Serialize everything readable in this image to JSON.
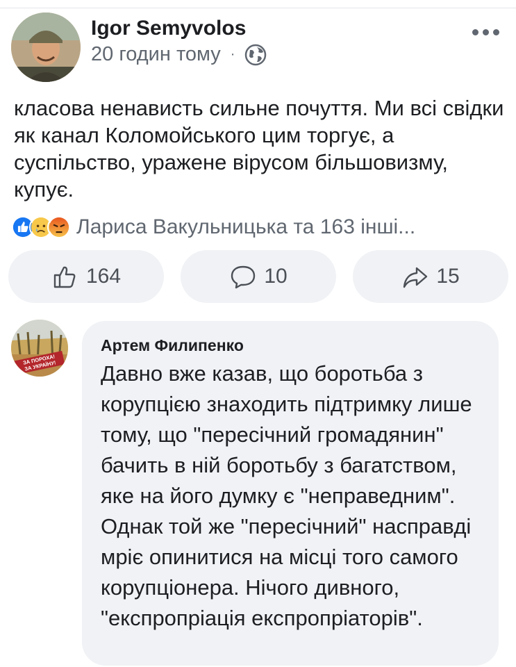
{
  "post": {
    "author": "Igor Semyvolos",
    "time": "20 годин тому",
    "separator": "·",
    "text": "класова ненависть сильне почуття. Ми всі свідки як канал Коломойського цим торгує, а суспільство, уражене вірусом більшовизму, купує."
  },
  "reactions": {
    "icons": [
      "like-icon",
      "sad-icon",
      "angry-icon"
    ],
    "summary": "Лариса Вакульницька та 163 інші..."
  },
  "actions": {
    "like_count": "164",
    "comment_count": "10",
    "share_count": "15"
  },
  "comment": {
    "author": "Артем Филипенко",
    "avatar_caption": "ЗА ПОРОХА! ЗА УКРАЇНУ!",
    "text": "Давно вже казав, що боротьба з корупцією знаходить підтримку лише тому, що \"пересічний громадянин\" бачить в ній боротьбу з багатством, яке на його думку є \"неправедним\". Однак той же \"пересічний\" насправді мріє опинитися на місці того самого корупціонера. Нічого дивного, \"експропріація експропріаторів\"."
  },
  "colors": {
    "like_blue": "#1877f2",
    "secondary_text": "#606770",
    "bubble_bg": "#f0f2f5",
    "avatar_badge_red": "#b3262b"
  }
}
